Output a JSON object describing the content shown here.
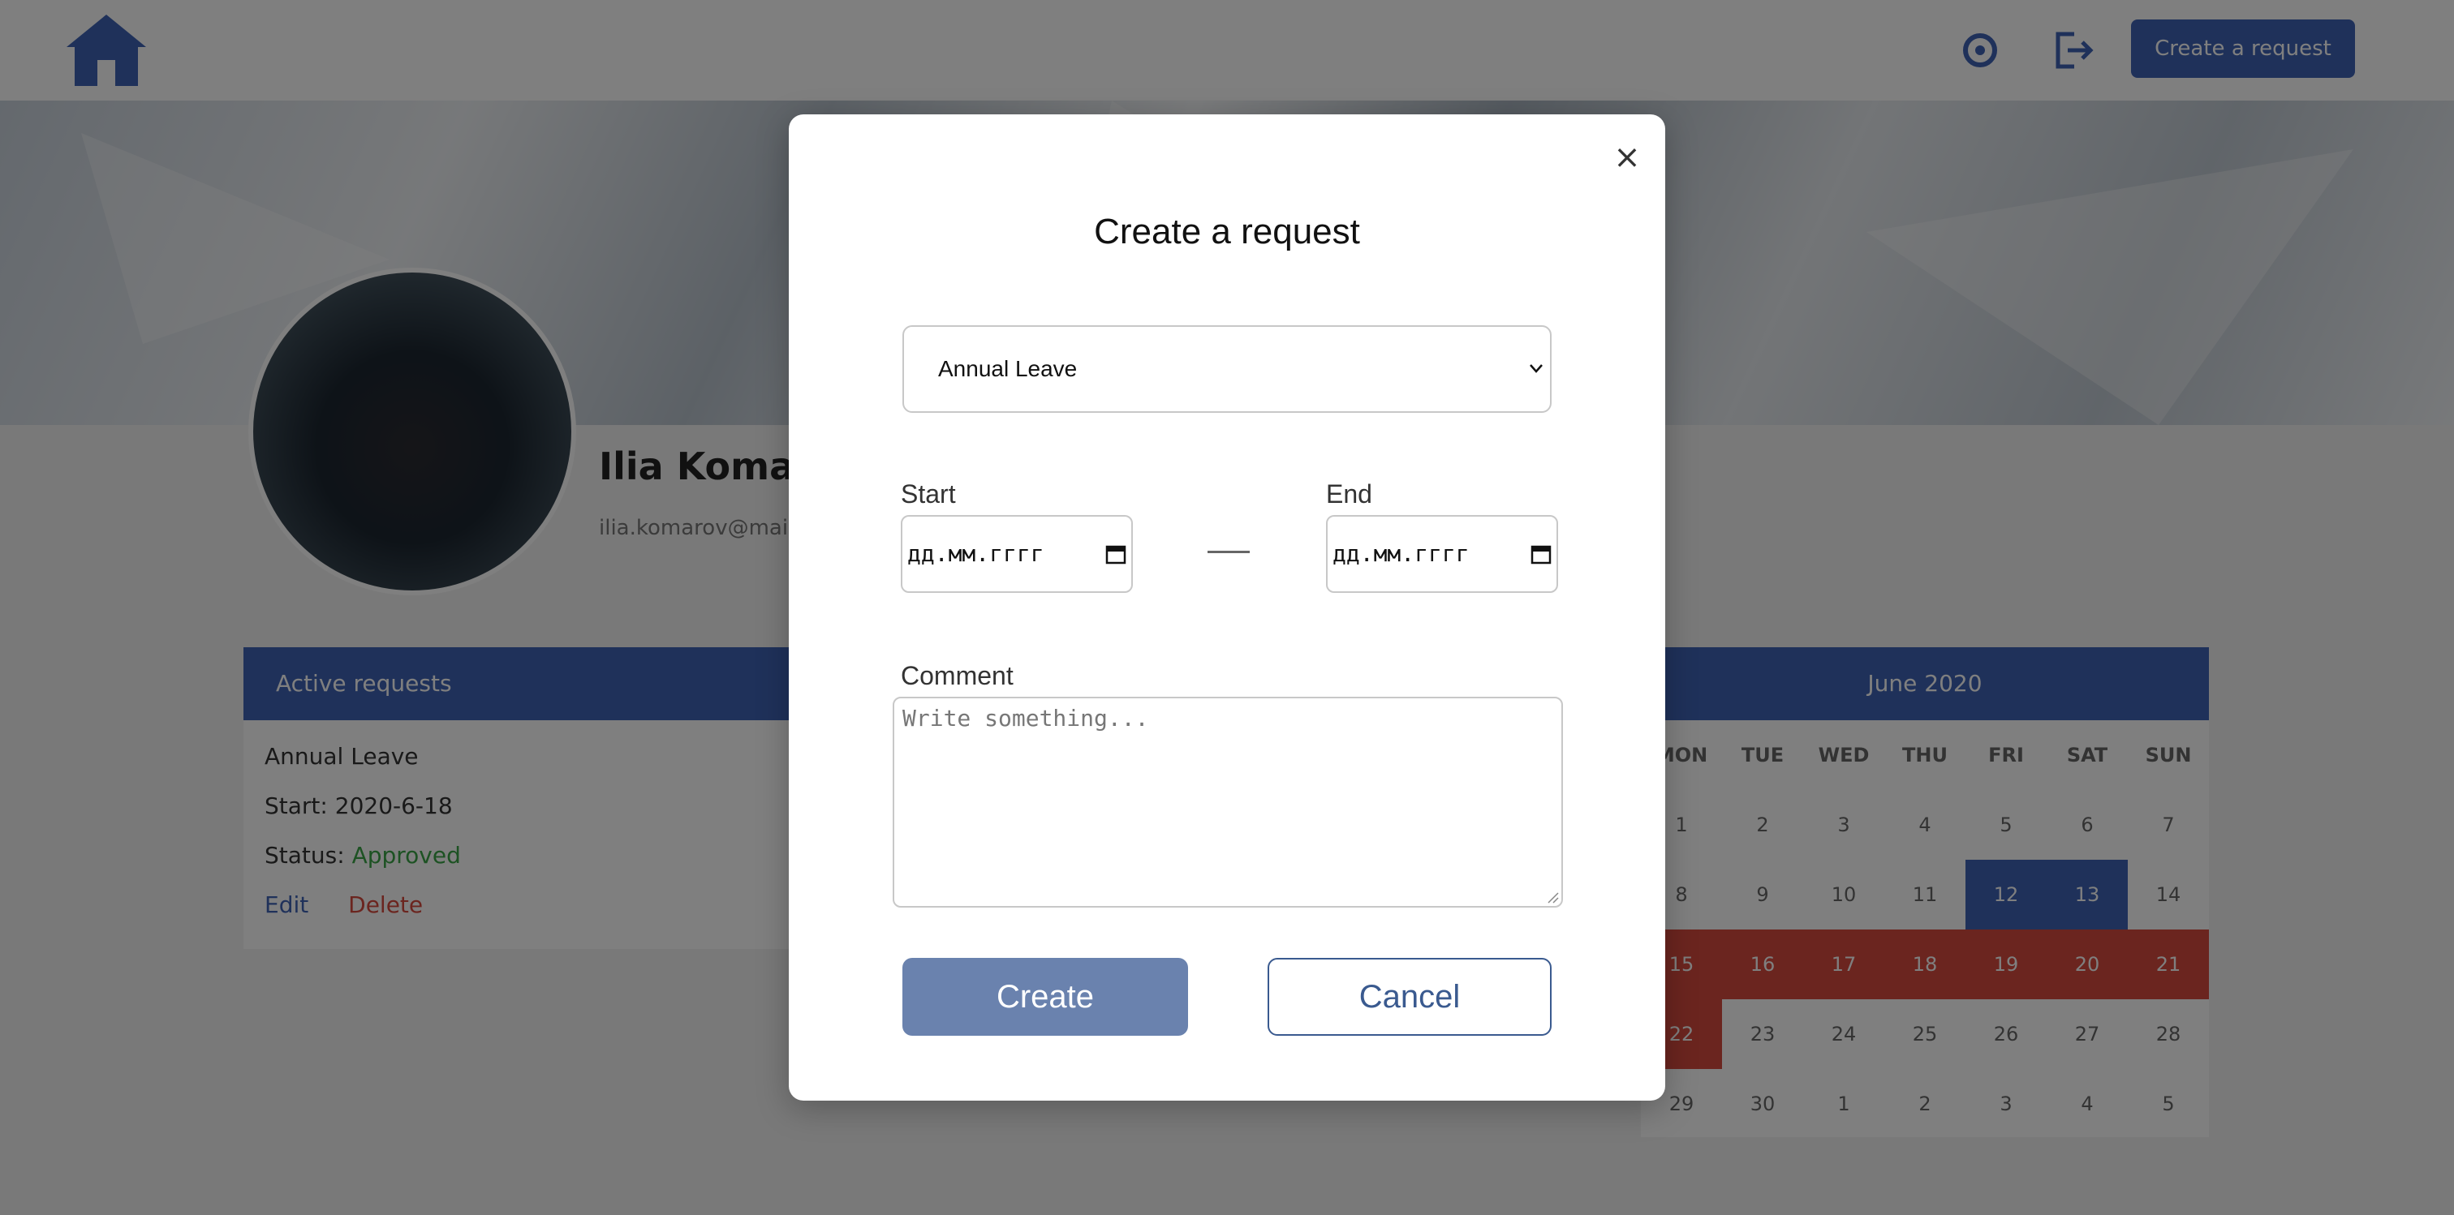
{
  "background": {
    "header": {
      "new_request_label": "Create a request",
      "icons": [
        "home-logo-icon",
        "settings-icon",
        "logout-icon"
      ]
    },
    "profile": {
      "name": "Ilia Komarov",
      "email": "ilia.komarov@mail.com"
    },
    "active_requests": {
      "title": "Active requests",
      "item_type": "Annual Leave",
      "start_label": "Start:",
      "start_value": "2020-6-18",
      "status_label": "Status:",
      "status_value": "Approved",
      "edit_label": "Edit",
      "delete_label": "Delete"
    },
    "calendar": {
      "month": "June 2020",
      "weekdays": [
        "MON",
        "TUE",
        "WED",
        "THU",
        "FRI",
        "SAT",
        "SUN"
      ],
      "days": [
        "1",
        "2",
        "3",
        "4",
        "5",
        "6",
        "7",
        "8",
        "9",
        "10",
        "11",
        "12",
        "13",
        "14",
        "15",
        "16",
        "17",
        "18",
        "19",
        "20",
        "21",
        "22",
        "23",
        "24",
        "25",
        "26",
        "27",
        "28",
        "29",
        "30",
        "1",
        "2",
        "3",
        "4",
        "5"
      ]
    },
    "colors": {
      "primary": "#3f63b5",
      "danger": "#d64a3f",
      "overlay": "rgba(0,0,0,0.5)"
    }
  },
  "modal": {
    "close_symbol": "×",
    "title": "Create a request",
    "leave_type": {
      "selected": "Annual Leave"
    },
    "start_label": "Start",
    "end_label": "End",
    "start_placeholder": "дд.мм.гггг",
    "end_placeholder": "дд.мм.гггг",
    "comment_label": "Comment",
    "comment_placeholder": "Write something...",
    "create_label": "Create",
    "cancel_label": "Cancel",
    "colors": {
      "create_bg": "#6a82ae",
      "cancel_border": "#3a5a8f"
    }
  }
}
